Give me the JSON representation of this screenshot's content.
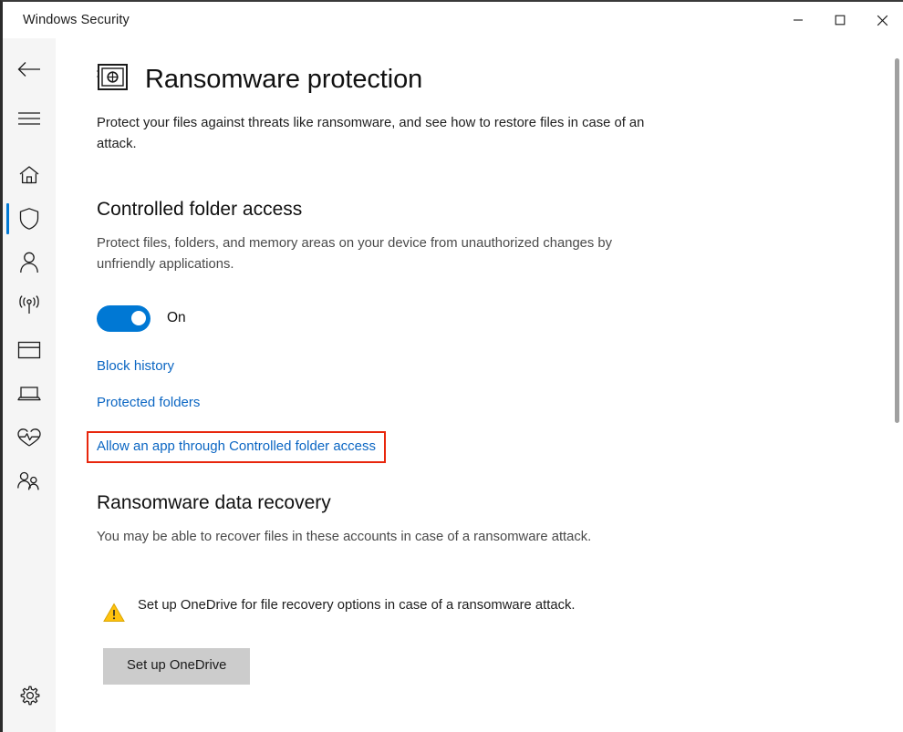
{
  "window": {
    "title": "Windows Security",
    "controls": {
      "minimize": "Minimize",
      "maximize": "Maximize",
      "close": "Close"
    }
  },
  "sidebar": {
    "items": [
      {
        "icon": "back-arrow-icon",
        "label": "Back",
        "selected": false
      },
      {
        "icon": "hamburger-menu-icon",
        "label": "Menu",
        "selected": false
      },
      {
        "icon": "home-icon",
        "label": "Home",
        "selected": false
      },
      {
        "icon": "shield-icon",
        "label": "Virus & threat protection",
        "selected": true
      },
      {
        "icon": "person-icon",
        "label": "Account protection",
        "selected": false
      },
      {
        "icon": "wifi-firewall-icon",
        "label": "Firewall & network protection",
        "selected": false
      },
      {
        "icon": "app-browser-icon",
        "label": "App & browser control",
        "selected": false
      },
      {
        "icon": "device-laptop-icon",
        "label": "Device security",
        "selected": false
      },
      {
        "icon": "heart-pulse-icon",
        "label": "Device performance & health",
        "selected": false
      },
      {
        "icon": "family-icon",
        "label": "Family options",
        "selected": false
      },
      {
        "icon": "gear-icon",
        "label": "Settings",
        "selected": false
      }
    ]
  },
  "page": {
    "icon": "vault-icon",
    "title": "Ransomware protection",
    "description": "Protect your files against threats like ransomware, and see how to restore files in case of an attack."
  },
  "controlled_folder_access": {
    "title": "Controlled folder access",
    "description": "Protect files, folders, and memory areas on your device from unauthorized changes by unfriendly applications.",
    "toggle_state": "On",
    "toggle_on": true,
    "links": [
      {
        "label": "Block history",
        "highlighted": false
      },
      {
        "label": "Protected folders",
        "highlighted": false
      },
      {
        "label": "Allow an app through Controlled folder access",
        "highlighted": true
      }
    ]
  },
  "ransomware_data_recovery": {
    "title": "Ransomware data recovery",
    "description": "You may be able to recover files in these accounts in case of a ransomware attack.",
    "warning": {
      "icon": "warning-triangle-icon",
      "text": "Set up OneDrive for file recovery options in case of a ransomware attack."
    },
    "button_label": "Set up OneDrive"
  },
  "colors": {
    "accent": "#0078d4",
    "link": "#0b66c3",
    "highlight_box": "#e8260c",
    "warning": "#ffc20e",
    "button_bg": "#cccccc",
    "sidebar_bg": "#f5f5f5"
  }
}
